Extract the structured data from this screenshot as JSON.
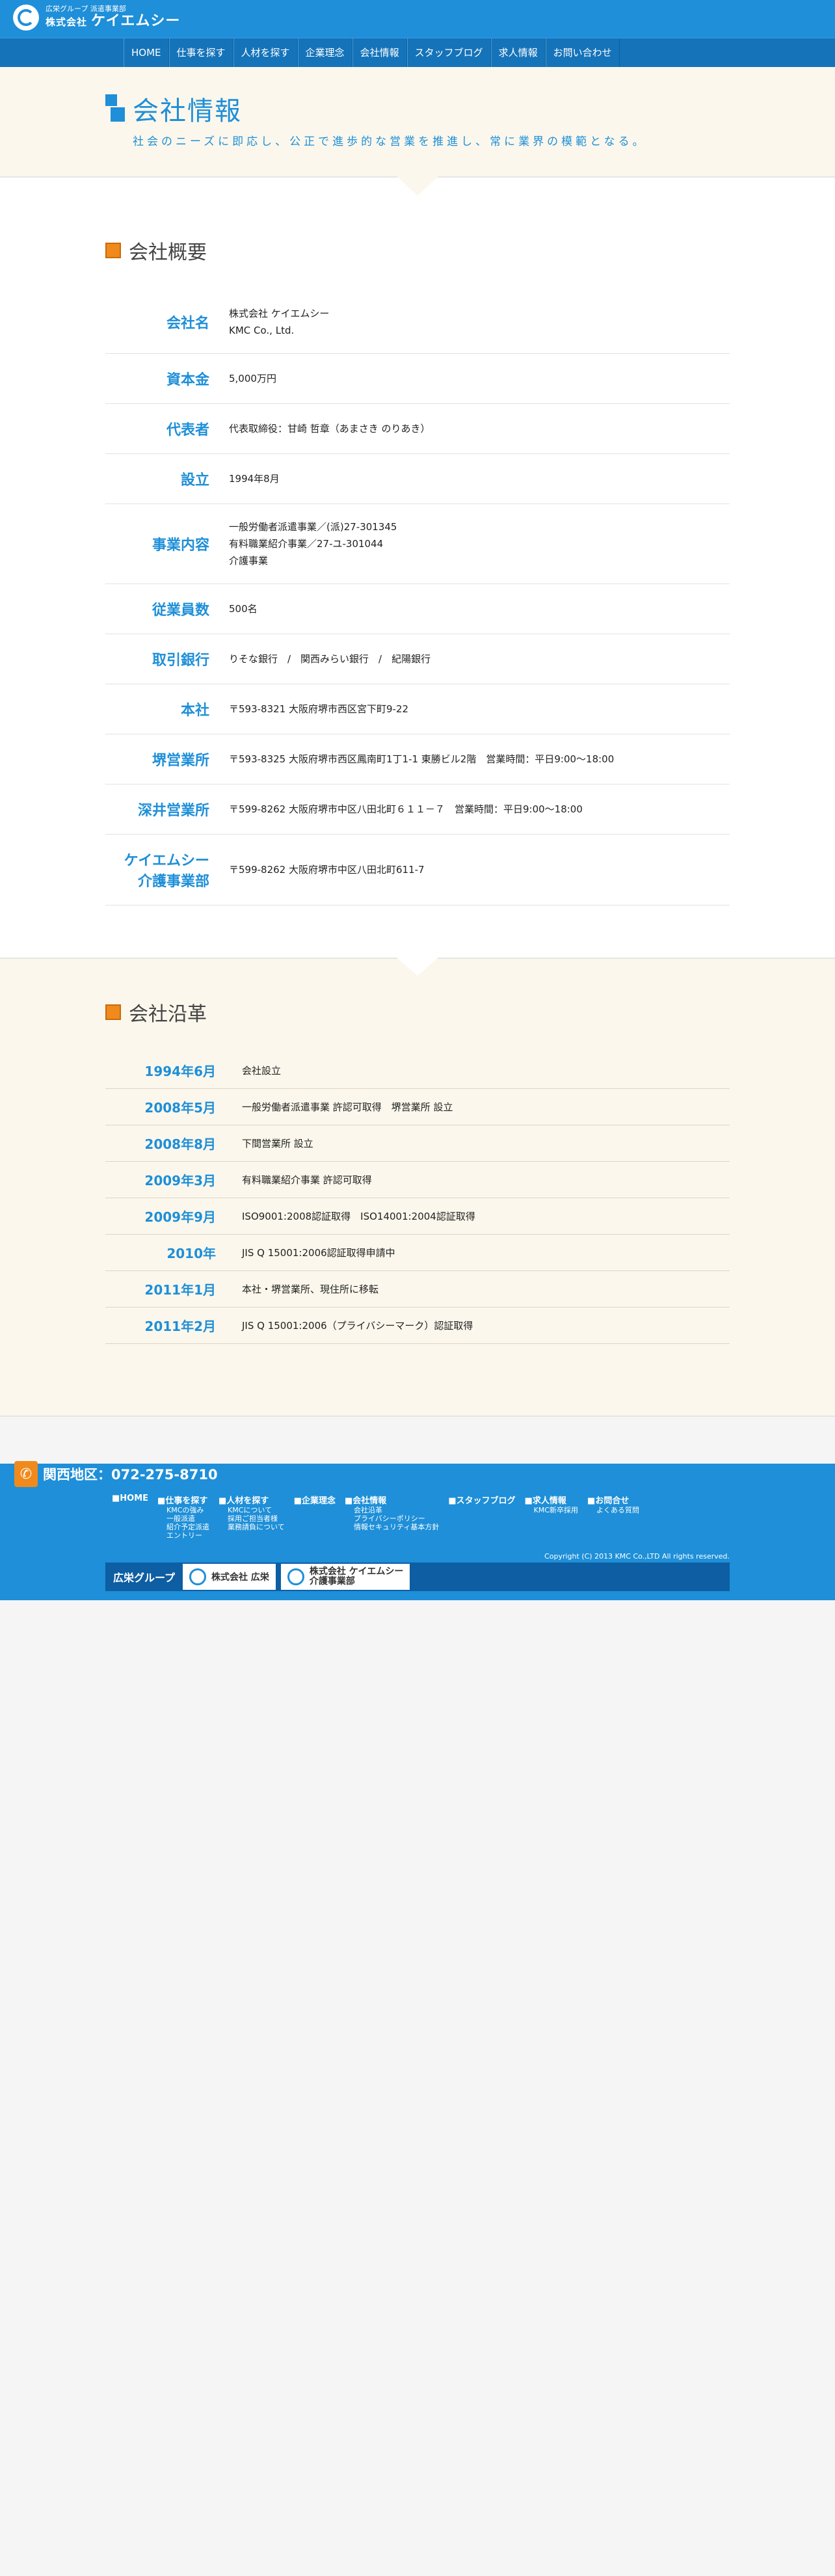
{
  "header": {
    "group_small": "広栄グループ 派遣事業部",
    "company_prefix": "株式会社",
    "company_name": "ケイエムシー"
  },
  "nav": [
    "HOME",
    "仕事を探す",
    "人材を探す",
    "企業理念",
    "会社情報",
    "スタッフブログ",
    "求人情報",
    "お問い合わせ"
  ],
  "hero": {
    "title": "会社情報",
    "subtitle": "社会のニーズに即応し、公正で進歩的な営業を推進し、常に業界の模範となる。"
  },
  "overview": {
    "title": "会社概要",
    "rows": [
      {
        "label": "会社名",
        "value": "株式会社 ケイエムシー\nKMC Co., Ltd."
      },
      {
        "label": "資本金",
        "value": "5,000万円"
      },
      {
        "label": "代表者",
        "value": "代表取締役：甘崎 哲章（あまさき のりあき）"
      },
      {
        "label": "設立",
        "value": "1994年8月"
      },
      {
        "label": "事業内容",
        "value": "一般労働者派遣事業／(派)27-301345\n有料職業紹介事業／27-ユ-301044\n介護事業"
      },
      {
        "label": "従業員数",
        "value": "500名"
      },
      {
        "label": "取引銀行",
        "value": "りそな銀行　/　関西みらい銀行　/　紀陽銀行"
      },
      {
        "label": "本社",
        "value": "〒593-8321 大阪府堺市西区宮下町9-22"
      },
      {
        "label": "堺営業所",
        "value": "〒593-8325 大阪府堺市西区鳳南町1丁1-1 東勝ビル2階　営業時間：平日9:00〜18:00"
      },
      {
        "label": "深井営業所",
        "value": "〒599-8262 大阪府堺市中区八田北町６１１－７　営業時間：平日9:00〜18:00"
      },
      {
        "label": "ケイエムシー\n介護事業部",
        "value": "〒599-8262 大阪府堺市中区八田北町611-7"
      }
    ]
  },
  "history": {
    "title": "会社沿革",
    "rows": [
      {
        "date": "1994年6月",
        "text": "会社設立"
      },
      {
        "date": "2008年5月",
        "text": "一般労働者派遣事業 許認可取得　堺営業所 設立"
      },
      {
        "date": "2008年8月",
        "text": "下間営業所 設立"
      },
      {
        "date": "2009年3月",
        "text": "有料職業紹介事業 許認可取得"
      },
      {
        "date": "2009年9月",
        "text": "ISO9001:2008認証取得　ISO14001:2004認証取得"
      },
      {
        "date": "2010年",
        "text": "JIS Q 15001:2006認証取得申請中"
      },
      {
        "date": "2011年1月",
        "text": "本社・堺営業所、現住所に移転"
      },
      {
        "date": "2011年2月",
        "text": "JIS Q 15001:2006（プライバシーマーク）認証取得"
      }
    ]
  },
  "footer": {
    "phone": "関西地区：072-275-8710",
    "nav": [
      {
        "head": "■HOME",
        "subs": []
      },
      {
        "head": "■仕事を探す",
        "subs": [
          "KMCの強み",
          "一般派遣",
          "紹介予定派遣",
          "エントリー"
        ]
      },
      {
        "head": "■人材を探す",
        "subs": [
          "KMCについて",
          "採用ご担当者様",
          "業務請負について"
        ]
      },
      {
        "head": "■企業理念",
        "subs": []
      },
      {
        "head": "■会社情報",
        "subs": [
          "会社沿革",
          "プライバシーポリシー",
          "情報セキュリティ基本方針"
        ]
      },
      {
        "head": "■スタッフブログ",
        "subs": []
      },
      {
        "head": "■求人情報",
        "subs": [
          "KMC新卒採用"
        ]
      },
      {
        "head": "■お問合せ",
        "subs": [
          "よくある質問"
        ]
      }
    ],
    "copyright": "Copyright (C) 2013 KMC Co.,LTD All rights reserved.",
    "group_label": "広栄グループ",
    "group_links": [
      "株式会社 広栄",
      "株式会社 ケイエムシー\n介護事業部"
    ]
  }
}
